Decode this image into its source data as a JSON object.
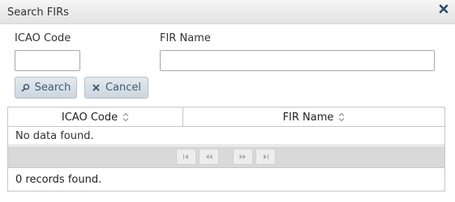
{
  "dialog": {
    "title": "Search FIRs",
    "close_icon": "close-icon"
  },
  "form": {
    "icao_label": "ICAO Code",
    "icao_value": "",
    "fir_label": "FIR Name",
    "fir_value": "",
    "search_label": "Search",
    "search_icon": "search-icon",
    "cancel_label": "Cancel",
    "cancel_icon": "close-icon"
  },
  "grid": {
    "columns": [
      "ICAO Code",
      "FIR Name"
    ],
    "empty_message": "No data found.",
    "paginator": {
      "buttons": [
        "first-page",
        "previous-page",
        "next-page",
        "last-page"
      ],
      "enabled": false
    },
    "footer": "0 records found."
  },
  "colors": {
    "button_text": "#3f5d78",
    "paginator_bg": "#d9d9d9"
  }
}
